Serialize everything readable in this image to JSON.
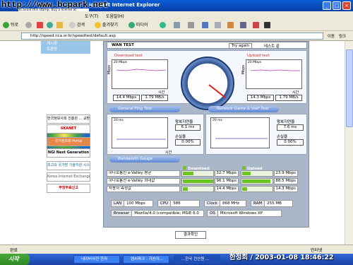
{
  "window": {
    "title": "icrosoft Internet Explorer",
    "watermark": "http://www.bcpark.net",
    "watermark_sub": "To avoid this stamp, buy a license at http://www.hypersnics.com"
  },
  "menu": {
    "items": [
      "도구(T)",
      "도움말(H)"
    ]
  },
  "toolbar": {
    "back": "뒤로",
    "search": "검색",
    "favorites": "즐겨찾기",
    "media": "미디어"
  },
  "address": {
    "url": "http://speed.nca.or.kr/speedtest/default.asp",
    "go": "이동",
    "links": "링크"
  },
  "leftnav": {
    "items": [
      "게시판",
      "토론방"
    ],
    "logos": [
      "한국정보사회 진흥원 ... 교환노드",
      "6KANET",
      "국가정보화 Portal",
      "NGI Next Generation",
      "초고속 국가망 기술지원 시스템",
      "Korea Internet Exchange",
      "부정무료신고"
    ]
  },
  "speedtest": {
    "header_left": "WAN TEST",
    "try_again": "Try again",
    "header_right": "테스트 끝",
    "download_title": "Download test",
    "upload_title": "Upload test",
    "graph_max": "20 Mbps",
    "ylabel_dl": "Mbps",
    "time_label": "시간",
    "download_values": [
      "14.4 Mbps",
      "1.79 MB/s"
    ],
    "upload_values": [
      "14.3 Mbps",
      "1.79 MB/s"
    ],
    "ping_tab": "General Ping Test",
    "game_tab": "Network Game & VoIP Test",
    "ping_graph_max": "20 ms",
    "ping_ylabel": "ms",
    "latency_label": "왕복지연율",
    "loss_label": "손실율",
    "ping_latency": "6.1 ms",
    "ping_loss": "0.00%",
    "game_latency": "7.6 ms",
    "game_loss": "0.00%",
    "bandwidth_tab": "Bandwidth Gauge",
    "bw_download_header": "Download",
    "bw_upload_header": "Upload",
    "bw_rows": [
      {
        "label": "하나로통신 e-Valley 평균",
        "dl": "32.7 Mbps",
        "ul": "23.9 Mbps",
        "dl_frac": 0.34,
        "ul_frac": 0.27
      },
      {
        "label": "하나로통신 e-Valley 최대값",
        "dl": "96.1 Mbps",
        "ul": "88.5 Mbps",
        "dl_frac": 0.98,
        "ul_frac": 0.9
      },
      {
        "label": "사용자 측정값",
        "dl": "14.4 Mbps",
        "ul": "14.3 Mbps",
        "dl_frac": 0.15,
        "ul_frac": 0.15
      }
    ],
    "specs": {
      "lan_label": "LAN",
      "lan": "100 Mbps",
      "cpu_label": "CPU",
      "cpu": "586",
      "clock_label": "Clock",
      "clock": "868 MHz",
      "ram_label": "RAM",
      "ram": "255 MB",
      "browser_label": "Browser",
      "browser": "Mozilla/4.0 (compatible; MSIE 6.0",
      "os_label": "OS",
      "os": "Microsoft Windows XP"
    },
    "result_button": "결과확인"
  },
  "status": {
    "left": "완료",
    "right": "인터넷"
  },
  "taskbar": {
    "start": "시작",
    "tasks": [
      "네이버사전 한자",
      "엠씨파크 : 가슴이...",
      "...한국 전산원 ..."
    ],
    "stamp": "한정희 / 2003-01-08 18:46:22"
  }
}
